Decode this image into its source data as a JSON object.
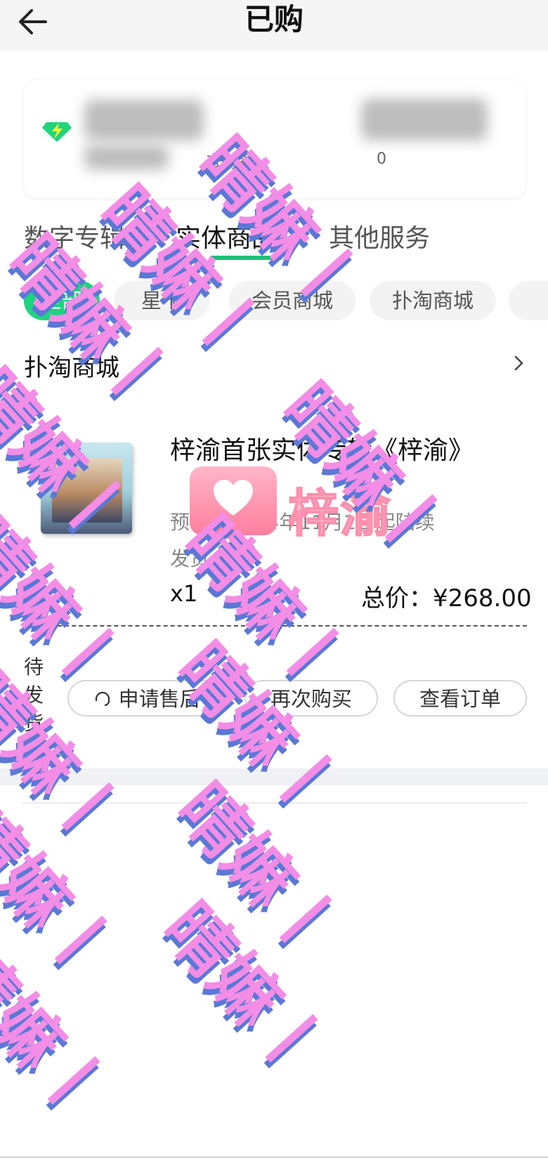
{
  "header": {
    "title": "已购"
  },
  "member_card": {
    "renew_label": "去续费",
    "value": "0"
  },
  "tabs": [
    {
      "label": "数字专辑"
    },
    {
      "label": "实体商品"
    },
    {
      "label": "其他服务"
    }
  ],
  "chips": [
    {
      "label": "全部"
    },
    {
      "label": "星卡"
    },
    {
      "label": "会员商城"
    },
    {
      "label": "扑淘商城"
    }
  ],
  "shop": {
    "name": "扑淘商城"
  },
  "order": {
    "product_title": "梓渝首张实体专辑《梓渝》",
    "meta_line1": "预售，2024年11月1日起陆续",
    "meta_line2": "发货 CD",
    "quantity": "x1",
    "total": "总价：¥268.00",
    "status": "待发货",
    "buttons": {
      "aftersale": "申请售后",
      "rebuy": "再次购买",
      "view": "查看订单"
    }
  },
  "sticker": {
    "text": "梓渝"
  },
  "watermark": {
    "text": "晴嫲丨"
  },
  "colors": {
    "accent": "#1ed47d",
    "watermark": "#f38de6",
    "watermark_shadow": "#5b78d6"
  },
  "icons": {
    "back": "arrow-left-icon",
    "gem": "lightning-gem-icon",
    "more": "chevron-right-icon",
    "service": "headset-icon"
  }
}
